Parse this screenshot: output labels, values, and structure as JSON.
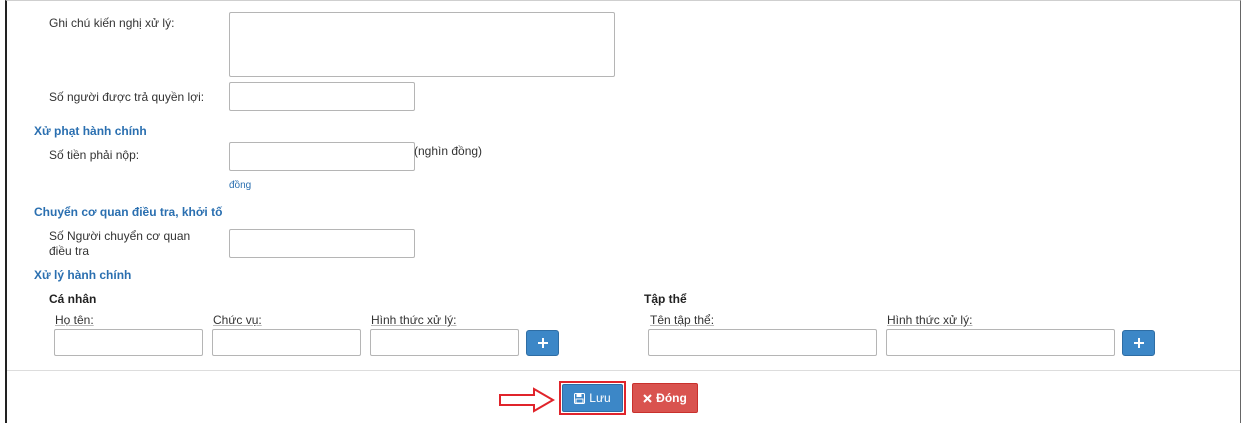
{
  "form": {
    "recommendation_note_label": "Ghi chú kiến nghị xử lý:",
    "recommendation_note_value": "",
    "beneficiaries_label": "Số người được trả quyền lợi:",
    "beneficiaries_value": ""
  },
  "admin_penalty": {
    "title": "Xử phạt hành chính",
    "amount_label": "Số tiền phải nộp:",
    "amount_value": "",
    "amount_unit": "(nghìn đồng)",
    "amount_hint": "đồng"
  },
  "investigation": {
    "title": "Chuyển cơ quan điều tra, khởi tố",
    "persons_label_line1": "Số Người chuyển cơ quan",
    "persons_label_line2": "điều tra",
    "persons_value": ""
  },
  "admin_handling": {
    "title": "Xử lý hành chính",
    "individual": {
      "title": "Cá nhân",
      "col_name": "Họ tên:",
      "col_position": "Chức vụ:",
      "col_form": "Hình thức xử lý:",
      "add_label": "+"
    },
    "collective": {
      "title": "Tập thể",
      "col_name": "Tên tập thể:",
      "col_form": "Hình thức xử lý:",
      "add_label": "+"
    }
  },
  "footer": {
    "save_label": "Lưu",
    "close_label": "Đóng"
  },
  "colors": {
    "primary": "#3c87c7",
    "danger": "#d9534f",
    "section_title": "#2a6fb0",
    "highlight": "#e0242b"
  },
  "icons": {
    "save": "floppy-disk-icon",
    "close": "x-icon",
    "add": "plus-icon",
    "pointer": "arrow-right-icon"
  }
}
